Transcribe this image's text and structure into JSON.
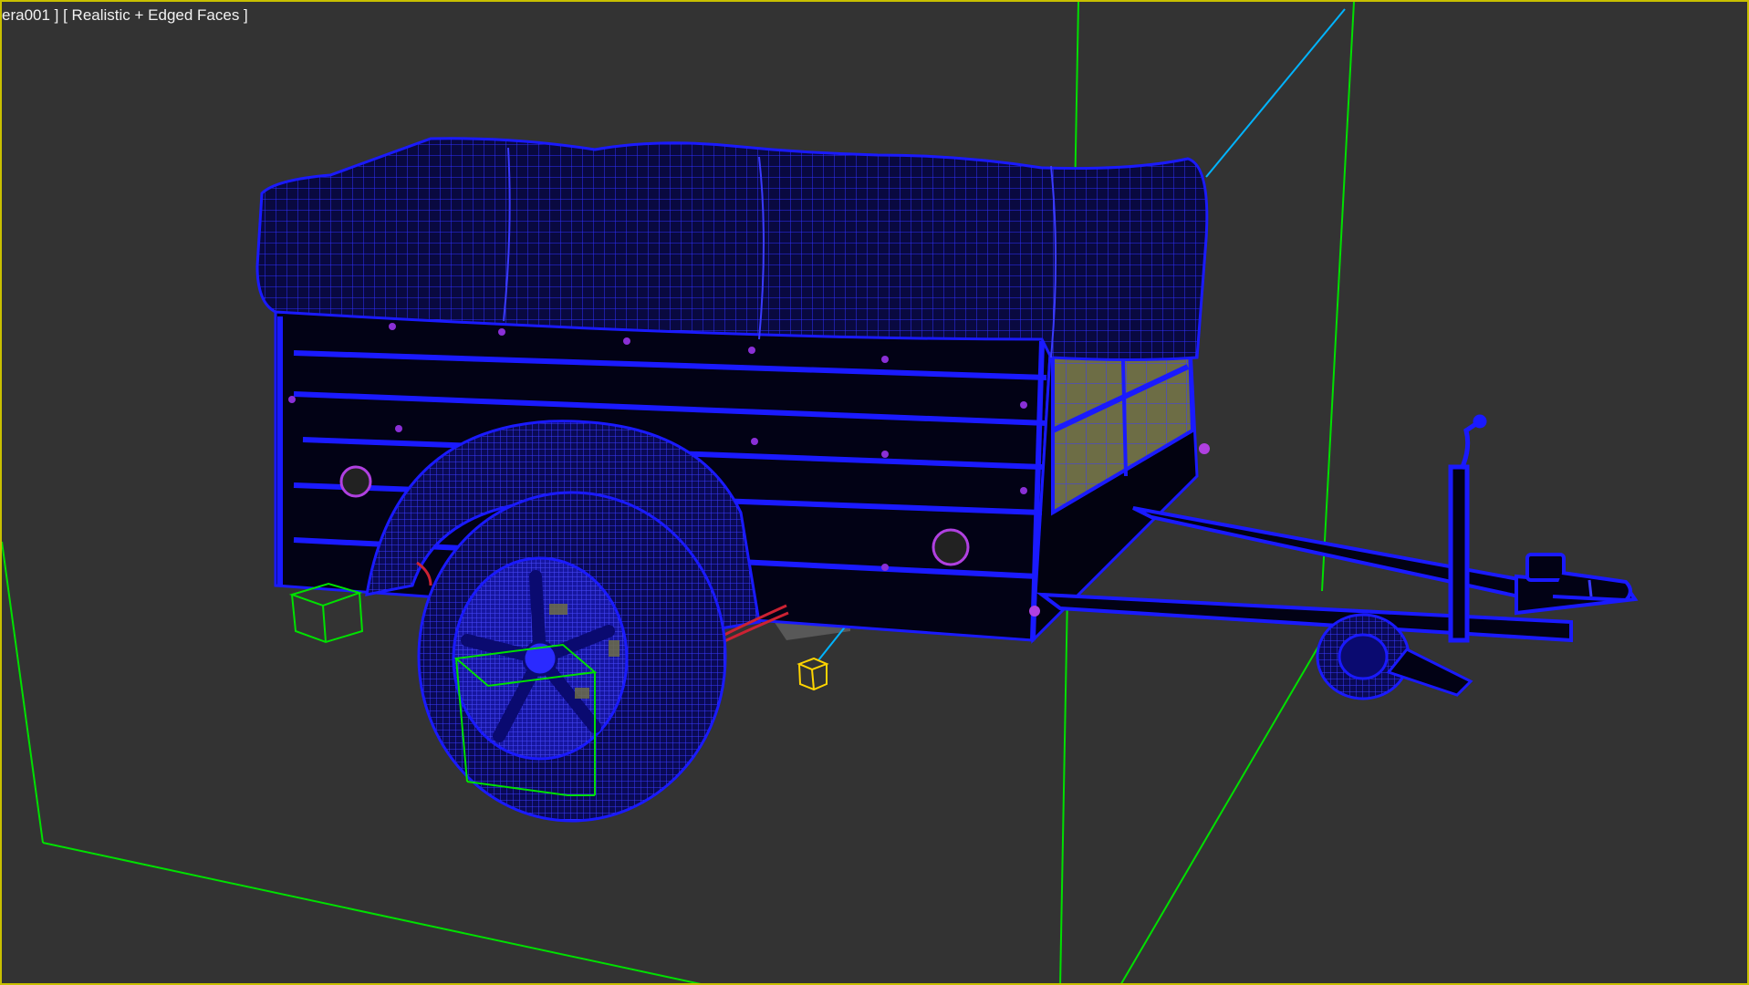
{
  "viewport": {
    "label": "era001 ] [ Realistic + Edged Faces ]",
    "active_border_color": "#c8c000",
    "background_color": "#333333"
  },
  "scene": {
    "object": "utility-trailer-wireframe",
    "wire_color": "#1a1aff",
    "selection_color": "#00e000",
    "helper_color": "#ffd400",
    "link_color": "#00b4ff"
  }
}
